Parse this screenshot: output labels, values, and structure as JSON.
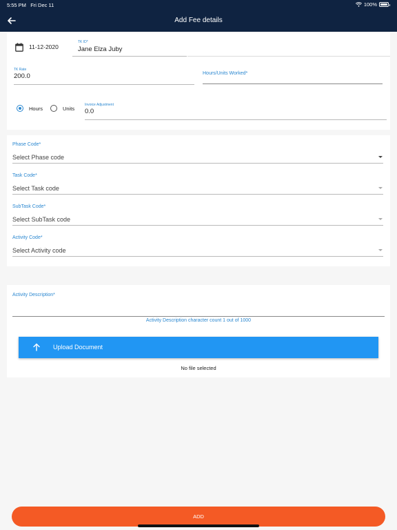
{
  "status_bar": {
    "time": "5:55 PM",
    "date": "Fri Dec 11",
    "battery": "100%"
  },
  "nav": {
    "title": "Add Fee details",
    "back_icon": "arrow-left-icon"
  },
  "form": {
    "date": "11-12-2020",
    "tk_id_label": "TK ID*",
    "tk_id_value": "Jane Elza Juby",
    "tk_rate_label": "TK Rate",
    "tk_rate_value": "200.0",
    "hours_units_label": "Hours/Units Worked*",
    "radio_hours": "Hours",
    "radio_units": "Units",
    "radio_selected": "Hours",
    "invoice_adj_label": "Invoice Adjustment",
    "invoice_adj_value": "0.0"
  },
  "codes": {
    "phase_label": "Phase Code*",
    "phase_placeholder": "Select Phase code",
    "task_label": "Task Code*",
    "task_placeholder": "Select Task code",
    "subtask_label": "SubTask Code*",
    "subtask_placeholder": "Select SubTask code",
    "activity_label": "Activity Code*",
    "activity_placeholder": "Select Activity code"
  },
  "description": {
    "label": "Activity Description*",
    "char_count": "Activity Description character count 1 out of 1000",
    "upload_label": "Upload Document",
    "file_status": "No file selected"
  },
  "footer": {
    "add_label": "ADD"
  },
  "colors": {
    "nav_bg": "#0f2341",
    "accent": "#2a87d0",
    "upload_btn": "#2196f3",
    "add_btn": "#f45a25"
  }
}
